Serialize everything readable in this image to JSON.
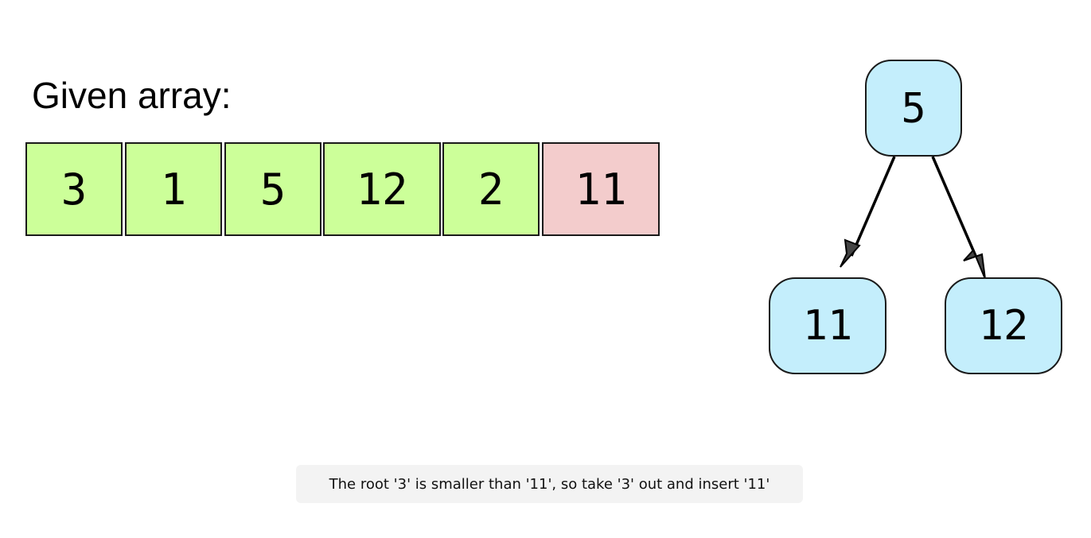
{
  "array_title": "Given array:",
  "array": [
    {
      "value": "3",
      "state": "done"
    },
    {
      "value": "1",
      "state": "done"
    },
    {
      "value": "5",
      "state": "done"
    },
    {
      "value": "12",
      "state": "done"
    },
    {
      "value": "2",
      "state": "done"
    },
    {
      "value": "11",
      "state": "current"
    }
  ],
  "tree": {
    "root": "5",
    "left": "11",
    "right": "12"
  },
  "caption": "The root '3' is smaller than '11', so take '3' out and insert '11'",
  "colors": {
    "processed_cell": "#ccff99",
    "current_cell": "#f3cccc",
    "tree_node": "#c4eefc",
    "caption_bg": "#f3f3f3"
  }
}
